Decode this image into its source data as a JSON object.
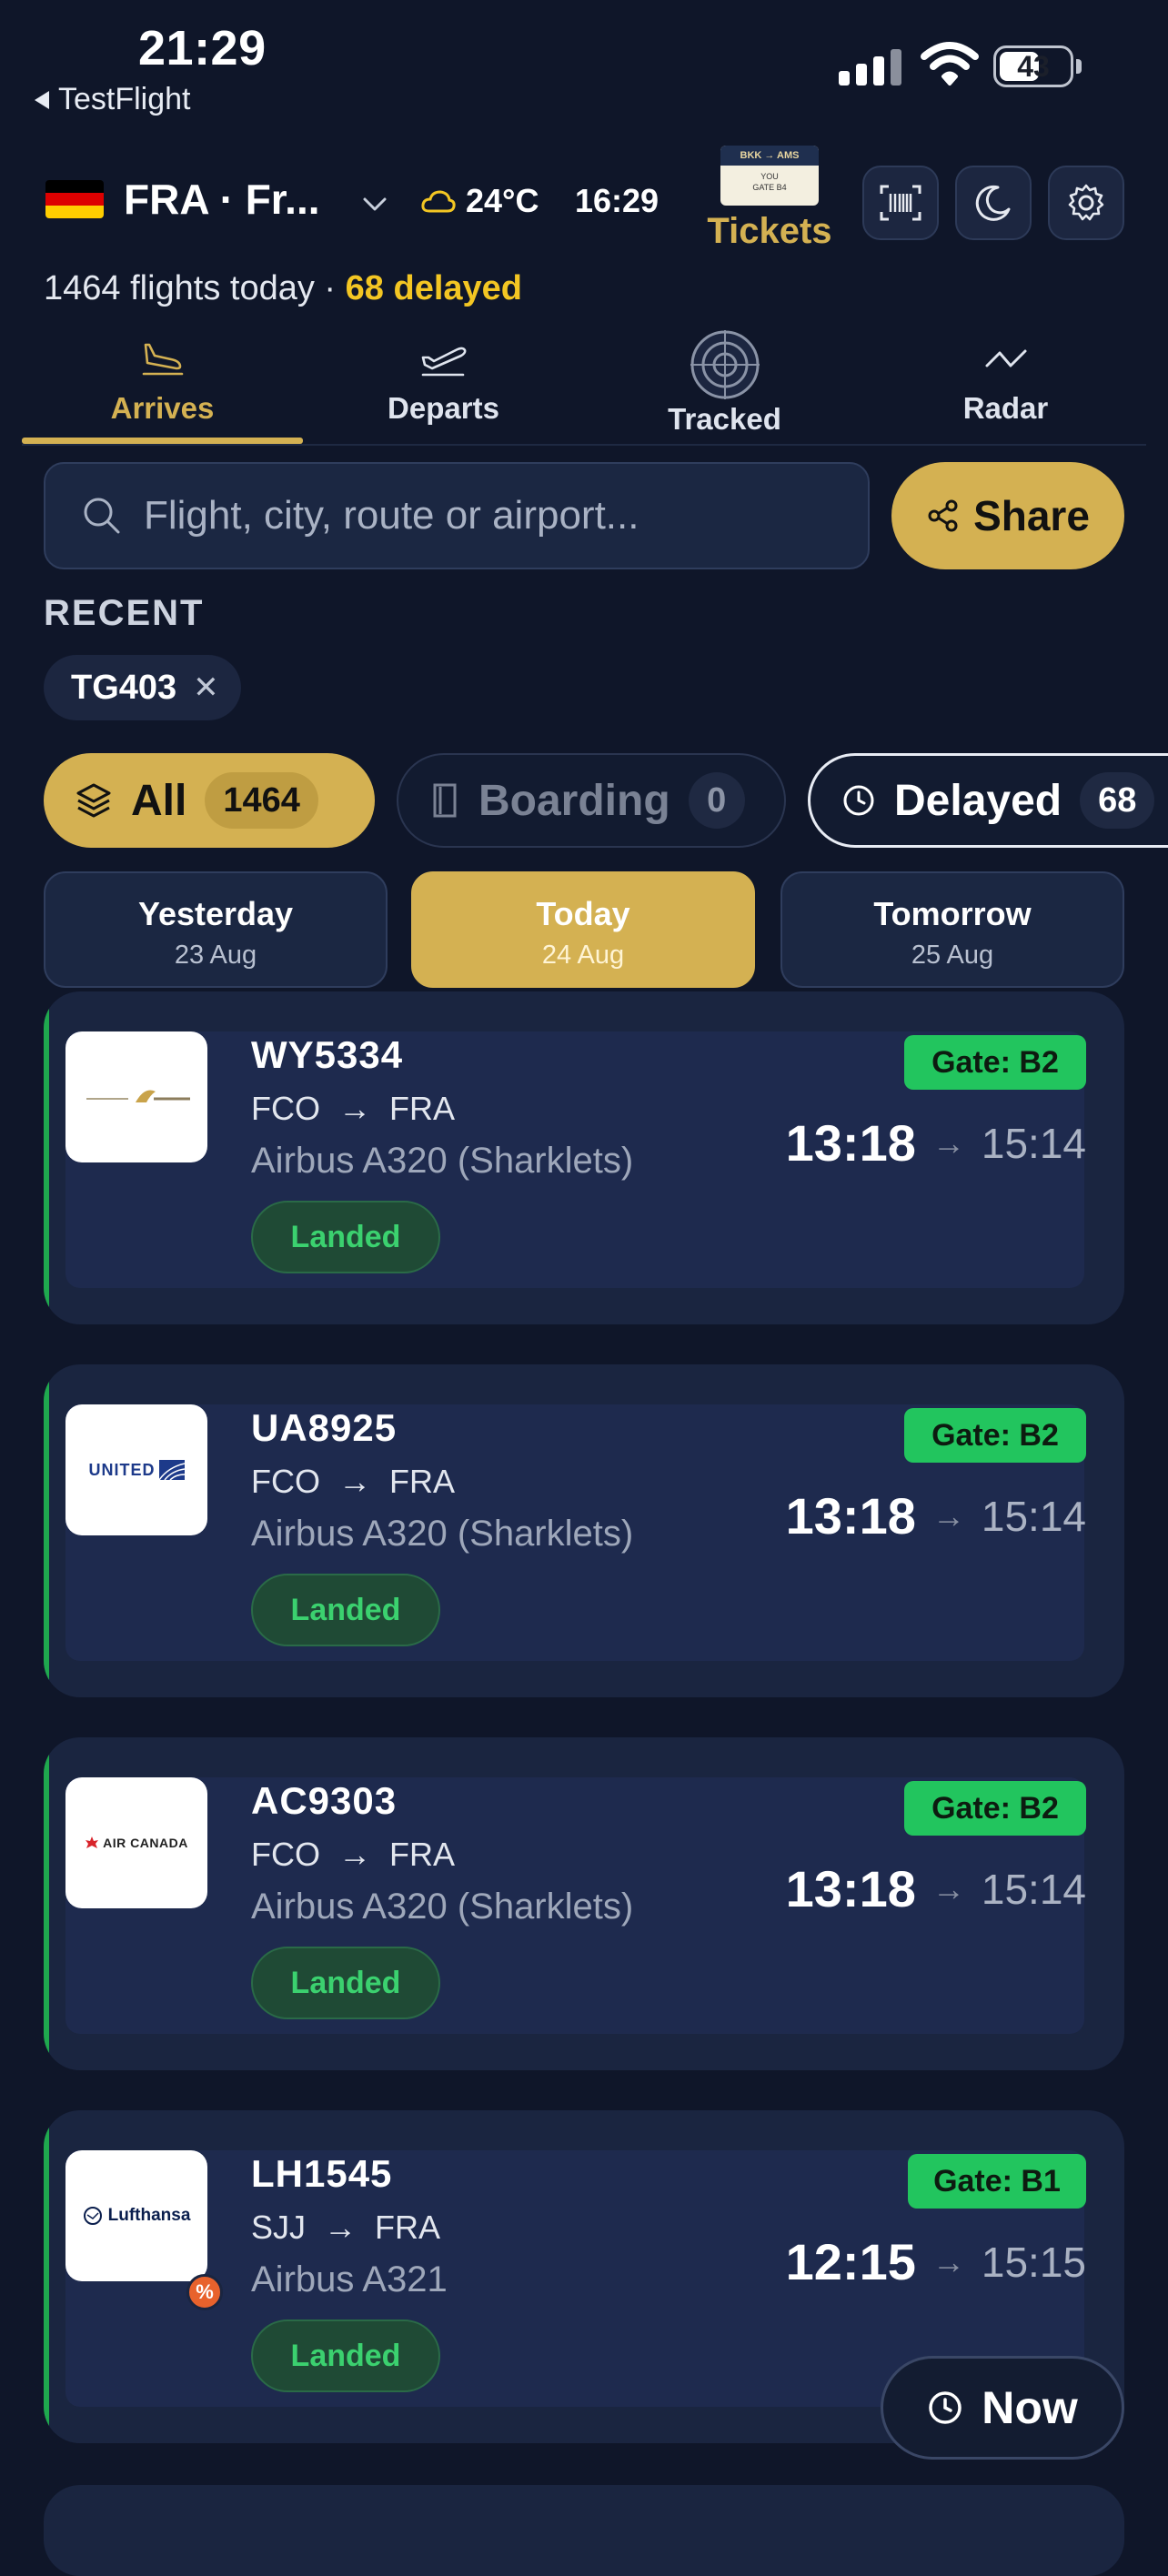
{
  "status_bar": {
    "time": "21:29",
    "back_label": "TestFlight",
    "battery": "43"
  },
  "header": {
    "airport": "FRA · Fr...",
    "weather_temp": "24°C",
    "local_time": "16:29",
    "tickets_label": "Tickets",
    "ticket_art": {
      "route": "BKK → AMS",
      "line1": "YOU",
      "line2": "GATE B4"
    },
    "summary_count": "1464 flights today · ",
    "summary_delayed": "68 delayed"
  },
  "tabs": [
    {
      "label": "Arrives",
      "icon": "plane-landing-icon",
      "active": true
    },
    {
      "label": "Departs",
      "icon": "plane-takeoff-icon",
      "active": false
    },
    {
      "label": "Tracked",
      "icon": "radar-target-icon",
      "active": false
    },
    {
      "label": "Radar",
      "icon": "pulse-icon",
      "active": false
    }
  ],
  "search": {
    "placeholder": "Flight, city, route or airport...",
    "share_label": "Share"
  },
  "recent": {
    "heading": "RECENT",
    "chips": [
      "TG403"
    ]
  },
  "filters": [
    {
      "label": "All",
      "count": "1464"
    },
    {
      "label": "Boarding",
      "count": "0"
    },
    {
      "label": "Delayed",
      "count": "68"
    }
  ],
  "days": [
    {
      "title": "Yesterday",
      "date": "23 Aug"
    },
    {
      "title": "Today",
      "date": "24 Aug"
    },
    {
      "title": "Tomorrow",
      "date": "25 Aug"
    }
  ],
  "flights": [
    {
      "number": "WY5334",
      "from": "FCO",
      "to": "FRA",
      "aircraft": "Airbus A320 (Sharklets)",
      "status": "Landed",
      "gate": "Gate: B2",
      "scheduled": "13:18",
      "actual": "15:14",
      "airline": "Oman Air"
    },
    {
      "number": "UA8925",
      "from": "FCO",
      "to": "FRA",
      "aircraft": "Airbus A320 (Sharklets)",
      "status": "Landed",
      "gate": "Gate: B2",
      "scheduled": "13:18",
      "actual": "15:14",
      "airline": "UNITED"
    },
    {
      "number": "AC9303",
      "from": "FCO",
      "to": "FRA",
      "aircraft": "Airbus A320 (Sharklets)",
      "status": "Landed",
      "gate": "Gate: B2",
      "scheduled": "13:18",
      "actual": "15:14",
      "airline": "AIR CANADA"
    },
    {
      "number": "LH1545",
      "from": "SJJ",
      "to": "FRA",
      "aircraft": "Airbus A321",
      "status": "Landed",
      "gate": "Gate: B1",
      "scheduled": "12:15",
      "actual": "15:15",
      "airline": "Lufthansa"
    }
  ],
  "discount_badge": "%",
  "now_button": "Now",
  "colors": {
    "accent": "#d4b152",
    "landed": "#3bd16f",
    "gate": "#22c55e",
    "delayed": "#f3c623"
  }
}
